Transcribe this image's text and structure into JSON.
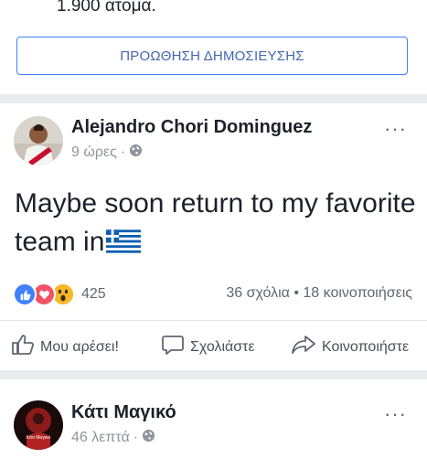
{
  "prev_post": {
    "reach_text": "1.900 άτομα.",
    "boost_label": "ΠΡΟΩΘΗΣΗ ΔΗΜΟΣΙΕΥΣΗΣ"
  },
  "post": {
    "author": "Alejandro Chori Dominguez",
    "time": "9 ώρες",
    "dot": "·",
    "text": "Maybe soon return to my favorite team in",
    "reaction_count": "425",
    "comments": "36 σχόλια",
    "sep": "•",
    "shares": "18 κοινοποιήσεις",
    "actions": {
      "like": "Μου αρέσει!",
      "comment": "Σχολιάστε",
      "share": "Κοινοποιήστε"
    },
    "colors": {
      "like": "#4080ff",
      "love": "#f25268",
      "wow": "#f7b928"
    }
  },
  "next_post": {
    "author": "Κάτι Μαγικό",
    "time": "46 λεπτά",
    "dot": "·",
    "avatar_text": "Κάτι Μαγικό"
  }
}
